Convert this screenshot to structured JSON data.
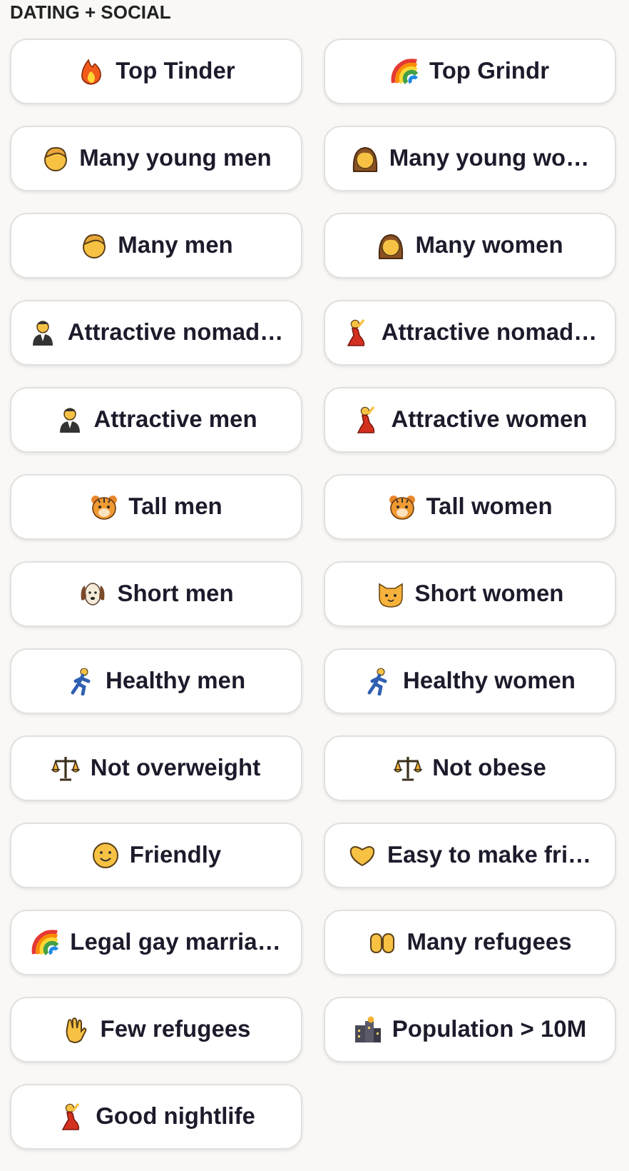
{
  "section": {
    "title": "DATING + SOCIAL"
  },
  "filters": [
    {
      "label": "Top Tinder"
    },
    {
      "label": "Top Grindr"
    },
    {
      "label": "Many young men"
    },
    {
      "label": "Many young wo…"
    },
    {
      "label": "Many men"
    },
    {
      "label": "Many women"
    },
    {
      "label": "Attractive nomad…"
    },
    {
      "label": "Attractive nomad…"
    },
    {
      "label": "Attractive men"
    },
    {
      "label": "Attractive women"
    },
    {
      "label": "Tall men"
    },
    {
      "label": "Tall women"
    },
    {
      "label": "Short men"
    },
    {
      "label": "Short women"
    },
    {
      "label": "Healthy men"
    },
    {
      "label": "Healthy women"
    },
    {
      "label": "Not overweight"
    },
    {
      "label": "Not obese"
    },
    {
      "label": "Friendly"
    },
    {
      "label": "Easy to make fri…"
    },
    {
      "label": "Legal gay marria…"
    },
    {
      "label": "Many refugees"
    },
    {
      "label": "Few refugees"
    },
    {
      "label": "Population > 10M"
    },
    {
      "label": "Good nightlife"
    }
  ]
}
